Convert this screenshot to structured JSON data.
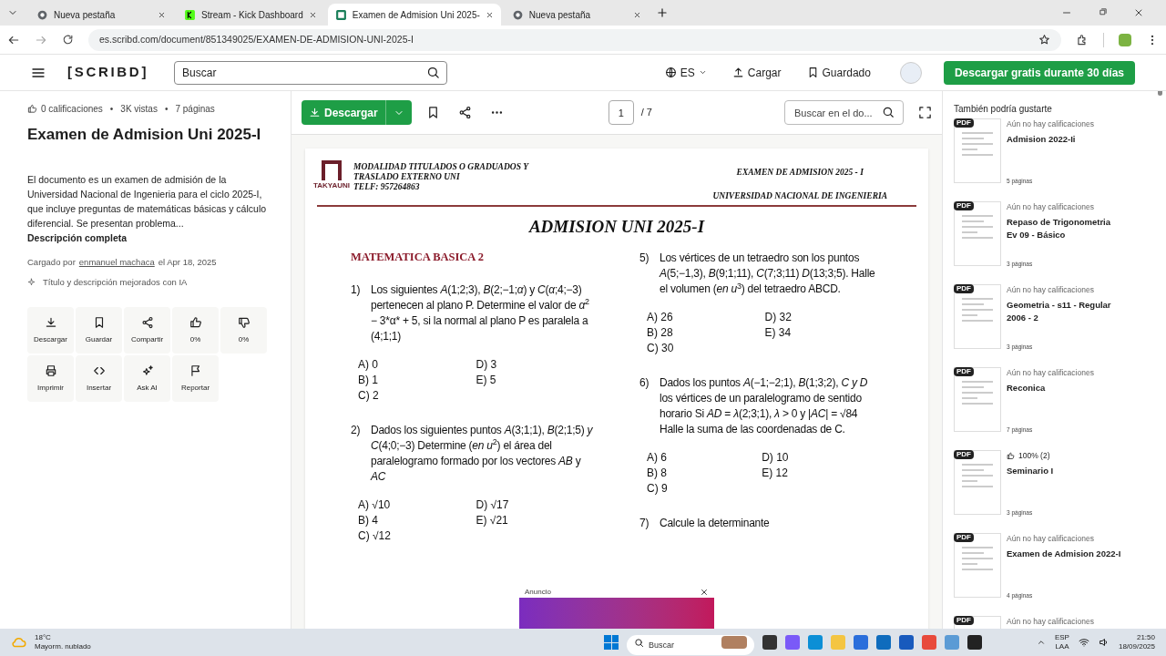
{
  "browser": {
    "tabs": [
      {
        "title": "Nueva pestaña",
        "selected": false,
        "kind": "newtab"
      },
      {
        "title": "Stream - Kick Dashboard",
        "selected": false,
        "kind": "site"
      },
      {
        "title": "Examen de Admision Uni 2025-",
        "selected": true,
        "kind": "site"
      },
      {
        "title": "Nueva pestaña",
        "selected": false,
        "kind": "newtab"
      }
    ],
    "url": "es.scribd.com/document/851349025/EXAMEN-DE-ADMISION-UNI-2025-I"
  },
  "header": {
    "logo": "[SCRIBD]",
    "search": {
      "placeholder": "Buscar"
    },
    "language": "ES",
    "upload": "Cargar",
    "saved": "Guardado",
    "cta": "Descargar gratis durante 30 días"
  },
  "details": {
    "stats": [
      "0 calificaciones",
      "3K vistas",
      "7 páginas"
    ],
    "separator": "•",
    "title": "Examen de Admision Uni 2025-I",
    "description": "El documento es un examen de admisión de la Universidad Nacional de Ingenieria para el ciclo 2025-I, que incluye preguntas de matemáticas básicas y cálculo diferencial. Se presentan problema...",
    "more": "Descripción completa",
    "uploaded": {
      "prefix": "Cargado por",
      "user": "enmanuel machaca",
      "suffix": "el Apr 18, 2025"
    },
    "ai_note": "Título y descripción mejorados con IA",
    "actions": [
      {
        "kind": "download",
        "label": "Descargar"
      },
      {
        "kind": "save",
        "label": "Guardar"
      },
      {
        "kind": "share",
        "label": "Compartir"
      },
      {
        "kind": "like",
        "label": "0%"
      },
      {
        "kind": "dislike",
        "label": "0%"
      },
      {
        "kind": "print",
        "label": "Imprimir"
      },
      {
        "kind": "embed",
        "label": "Insertar"
      },
      {
        "kind": "ai",
        "label": "Ask AI"
      },
      {
        "kind": "report",
        "label": "Reportar"
      }
    ]
  },
  "toolbar": {
    "download": "Descargar",
    "page": "1",
    "page_total": "/ 7",
    "search": {
      "placeholder": "Buscar en el do..."
    }
  },
  "document": {
    "header_left": [
      "MODALIDAD TITULADOS O GRADUADOS Y",
      "TRASLADO EXTERNO UNI",
      "TELF: 957264863"
    ],
    "logo_text": "TAKYAUNI",
    "header_right": [
      "EXAMEN DE ADMISION 2025 - I",
      "UNIVERSIDAD NACIONAL DE INGENIERIA"
    ],
    "title": "ADMISION UNI 2025-I",
    "section": "MATEMATICA BASICA 2",
    "columns": [
      [
        {
          "number": "1)",
          "text": "Los siguientes *A*(1;2;3), *B*(2;−1;*α*) y *C*(*α*;4;−3) pertenecen al plano P. Determine el valor de *α*$^{2}$ − 3*α* + 5, si la normal al plano P es paralela a (4;1;1)",
          "options": [
            {
              "label": "A)",
              "value": "0"
            },
            {
              "label": "B)",
              "value": "1"
            },
            {
              "label": "C)",
              "value": "2"
            },
            {
              "label": "D)",
              "value": "3"
            },
            {
              "label": "E)",
              "value": "5"
            }
          ]
        },
        {
          "number": "2)",
          "text": "Dados los siguientes puntos *A*(3;1;1), *B*(2;1;5) *y C*(4;0;−3) Determine (*en u*$^{2}$) el área del paralelogramo formado por los vectores *AB* y *AC*",
          "options": [
            {
              "label": "A)",
              "value": "√10"
            },
            {
              "label": "B)",
              "value": "4"
            },
            {
              "label": "C)",
              "value": "√12"
            },
            {
              "label": "D)",
              "value": "√17"
            },
            {
              "label": "E)",
              "value": "√21"
            }
          ]
        }
      ],
      [
        {
          "number": "5)",
          "text": "Los vértices de un tetraedro son los puntos *A*(5;−1,3), *B*(9;1;11), *C*(7;3;11) *D*(13;3;5). Halle el volumen (*en u*$^{3}$) del tetraedro ABCD.",
          "options": [
            {
              "label": "A)",
              "value": "26"
            },
            {
              "label": "B)",
              "value": "28"
            },
            {
              "label": "C)",
              "value": "30"
            },
            {
              "label": "D)",
              "value": "32"
            },
            {
              "label": "E)",
              "value": "34"
            }
          ]
        },
        {
          "number": "6)",
          "text": "Dados los puntos *A*(−1;−2;1), *B*(1;3;2), *C y D* los vértices de un paralelogramo de sentido horario Si *AD* = *λ*(2;3;1), *λ* > 0 y |*AC*| = √84 Halle la suma de las coordenadas de C.",
          "options": [
            {
              "label": "A)",
              "value": "6"
            },
            {
              "label": "B)",
              "value": "8"
            },
            {
              "label": "C)",
              "value": "9"
            },
            {
              "label": "D)",
              "value": "10"
            },
            {
              "label": "E)",
              "value": "12"
            }
          ]
        },
        {
          "number": "7)",
          "text": "Calcule la determinante"
        }
      ]
    ]
  },
  "ad": {
    "label": "Anuncio"
  },
  "related": {
    "heading": "También podría gustarte",
    "items": [
      {
        "badge": "PDF",
        "rated": false,
        "rating": "Aún no hay calificaciones",
        "title": "Admision 2022-Ii",
        "pages": "5 páginas"
      },
      {
        "badge": "PDF",
        "rated": false,
        "rating": "Aún no hay calificaciones",
        "title": "Repaso de Trigonometria Ev 09 - Básico",
        "pages": "3 páginas"
      },
      {
        "badge": "PDF",
        "rated": false,
        "rating": "Aún no hay calificaciones",
        "title": "Geometria - s11 - Regular 2006 - 2",
        "pages": "3 páginas"
      },
      {
        "badge": "PDF",
        "rated": false,
        "rating": "Aún no hay calificaciones",
        "title": "Reconica",
        "pages": "7 páginas"
      },
      {
        "badge": "PDF",
        "rated": true,
        "rating": "100% (2)",
        "title": "Seminario I",
        "pages": "3 páginas"
      },
      {
        "badge": "PDF",
        "rated": false,
        "rating": "Aún no hay calificaciones",
        "title": "Examen de Admision 2022-I",
        "pages": "4 páginas"
      },
      {
        "badge": "PDF",
        "rated": false,
        "rating": "Aún no hay calificaciones"
      }
    ]
  },
  "taskbar": {
    "temperature": "18°C",
    "weather": "Mayorm. nublado",
    "search": {
      "placeholder": "Buscar"
    },
    "language": [
      "ESP",
      "LAA"
    ],
    "time": "21:50",
    "date": "18/09/2025"
  }
}
